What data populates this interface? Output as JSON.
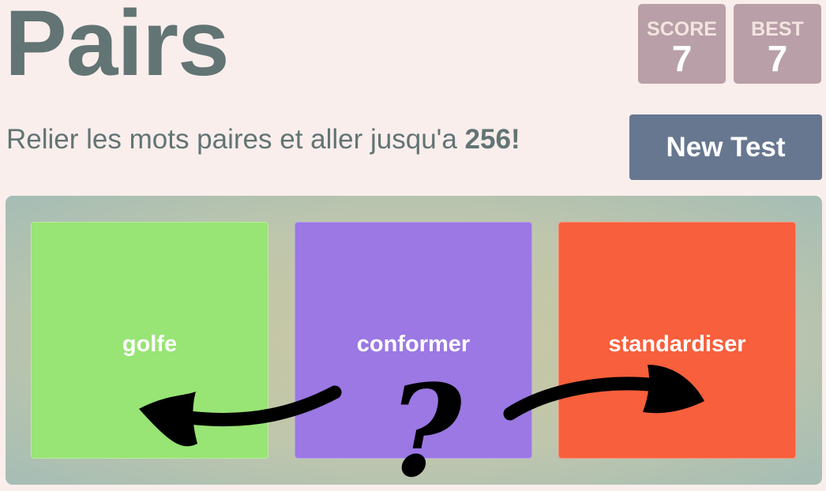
{
  "header": {
    "title": "Pairs",
    "subtitle_prefix": "Relier les mots paires et aller jusqu'a ",
    "subtitle_target": "256",
    "subtitle_suffix": "!"
  },
  "scores": {
    "score_label": "SCORE",
    "score_value": "7",
    "best_label": "BEST",
    "best_value": "7"
  },
  "controls": {
    "new_test_label": "New Test"
  },
  "tiles": [
    {
      "word": "golfe",
      "color": "#98e475"
    },
    {
      "word": "conformer",
      "color": "#9b78e3"
    },
    {
      "word": "standardiser",
      "color": "#f85f3c"
    }
  ],
  "hint_glyph": "?",
  "icons": [
    "left-arrow-icon",
    "right-arrow-icon",
    "question-mark-icon"
  ]
}
